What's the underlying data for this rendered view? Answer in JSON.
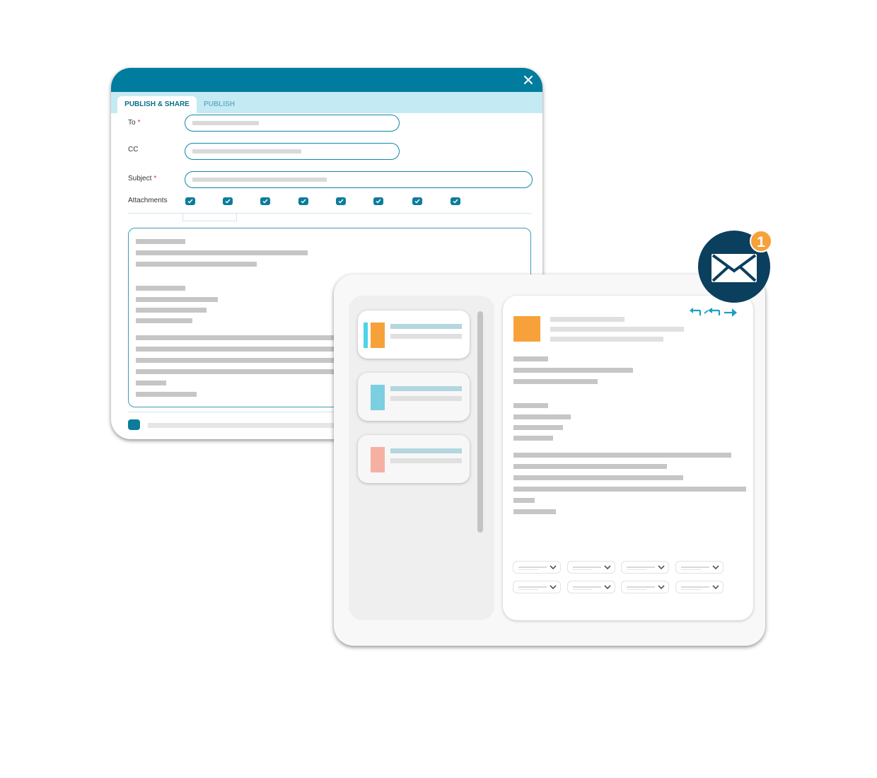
{
  "compose": {
    "tabs": [
      {
        "label": "PUBLISH & SHARE",
        "active": true
      },
      {
        "label": "PUBLISH",
        "active": false
      }
    ],
    "fields": {
      "to_label": "To",
      "cc_label": "CC",
      "subject_label": "Subject",
      "attachments_label": "Attachments",
      "required_mark": "*"
    },
    "attachments_checked": [
      true,
      true,
      true,
      true,
      true,
      true,
      true,
      true
    ]
  },
  "mail": {
    "notification_count": "1",
    "message_cards": [
      {
        "accent_colors": [
          "#4dd3ea",
          "#f7a13b"
        ],
        "selected": true
      },
      {
        "accent_colors": [
          "#7ccfe0"
        ],
        "selected": false
      },
      {
        "accent_colors": [
          "#f4b1a2"
        ],
        "selected": false
      }
    ],
    "sender_avatar_color": "#f7a13b",
    "actions": [
      "reply-icon",
      "reply-all-icon",
      "forward-icon"
    ]
  },
  "colors": {
    "header": "#007c9e",
    "tabbar": "#c4eaf4",
    "accent": "#0d7c9c",
    "badge": "#f7a13b",
    "mail_icon_bg": "#0b3f5e"
  }
}
